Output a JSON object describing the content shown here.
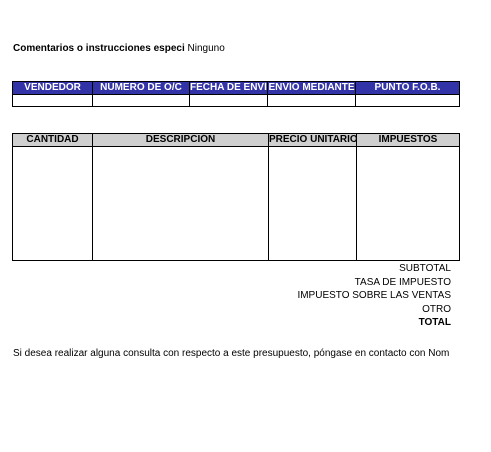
{
  "comments": {
    "label": "Comentarios o instrucciones especi",
    "value": "Ninguno"
  },
  "shipping_table": {
    "headers": [
      "VENDEDOR",
      "NÚMERO DE O/C",
      "FECHA DE ENVÍO",
      "ENVÍO MEDIANTE",
      "PUNTO F.O.B."
    ]
  },
  "items_table": {
    "headers": [
      "CANTIDAD",
      "DESCRIPCIÓN",
      "PRECIO UNITARIO",
      "IMPUESTOS"
    ]
  },
  "totals": {
    "subtotal": "SUBTOTAL",
    "tax_rate": "TASA DE IMPUESTO",
    "sales_tax": "IMPUESTO SOBRE LAS VENTAS",
    "other": "OTRO",
    "total": "TOTAL"
  },
  "footer": "Si desea realizar alguna consulta con respecto a este presupuesto, póngase en contacto con Nom"
}
